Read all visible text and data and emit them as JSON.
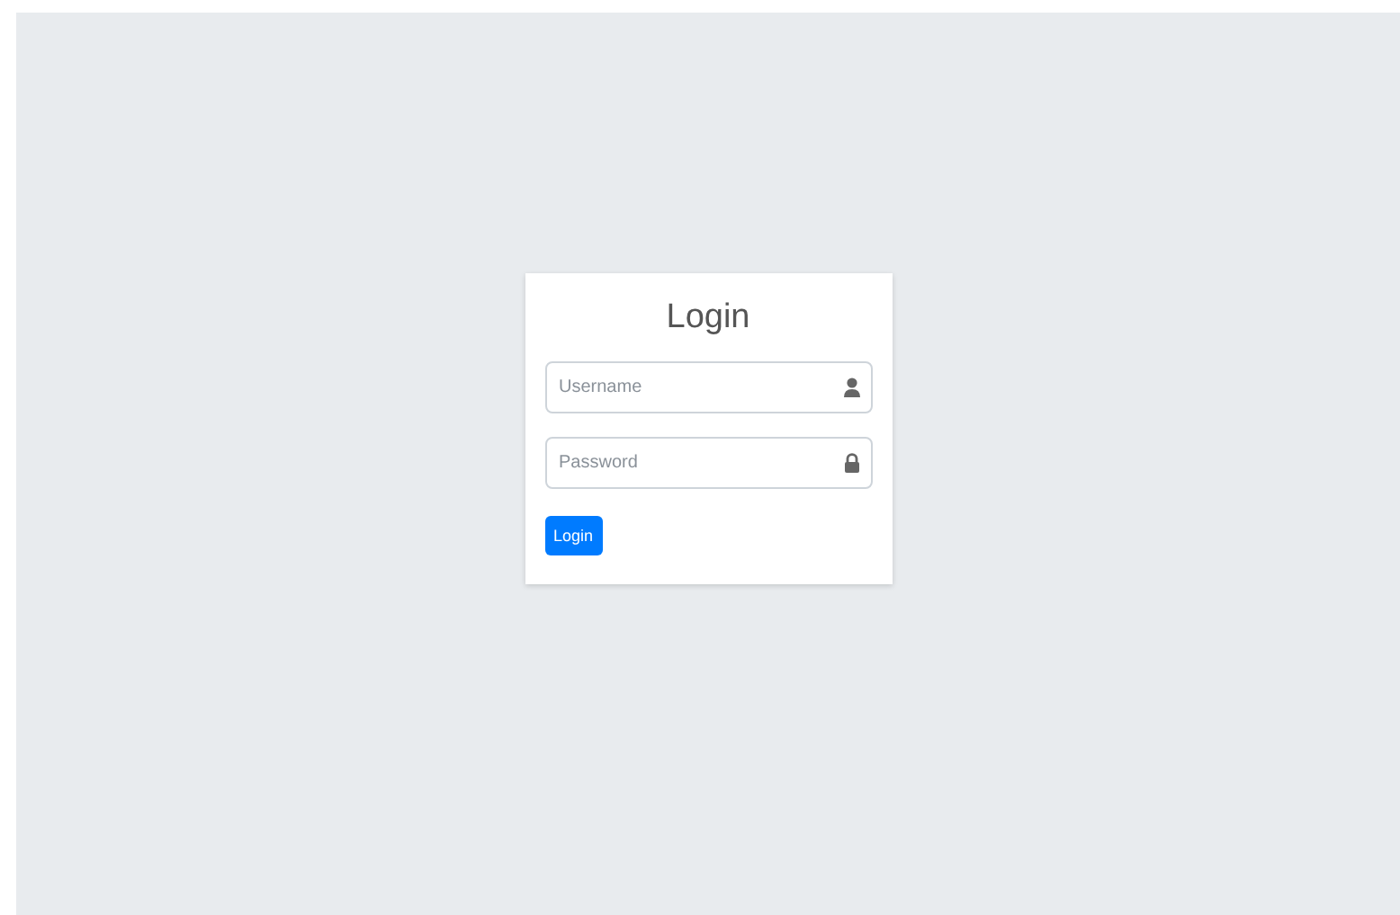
{
  "title": "Login",
  "fields": [
    {
      "kind": "user",
      "placeholder": "Username"
    },
    {
      "kind": "lock",
      "placeholder": "Password"
    }
  ],
  "button": "Login"
}
